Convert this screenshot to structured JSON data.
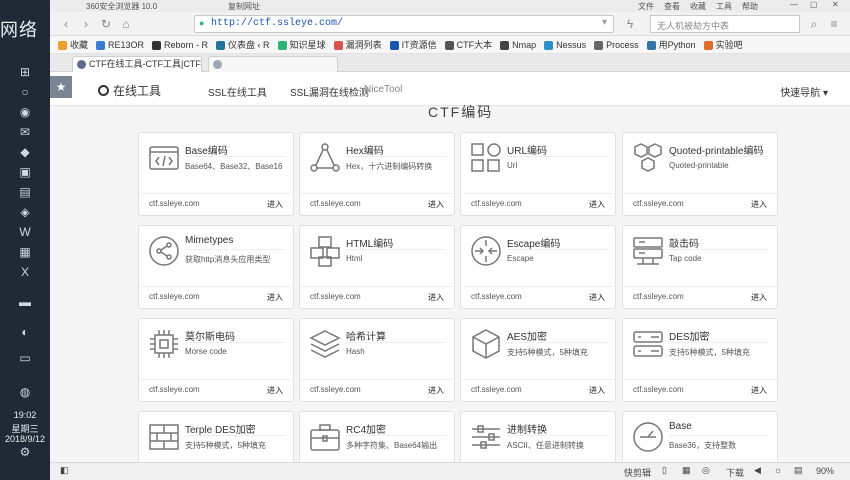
{
  "taskbar": {
    "desktop_text": "网络",
    "time": "19:02",
    "weekday": "星期三",
    "date": "2018/9/12"
  },
  "browser": {
    "app_title": "360安全浏览器 10.0",
    "menu": [
      "文件",
      "查看",
      "收藏",
      "工具",
      "帮助"
    ],
    "url": "http://ctf.ssleye.com/",
    "copy_url_label": "复制网址",
    "search_placeholder": "无人机被劫方中表",
    "bookmarks": [
      {
        "label": "收藏",
        "color": "#f0a030"
      },
      {
        "label": "RE13OR",
        "color": "#3a7bd5"
      },
      {
        "label": "Reborn - R",
        "color": "#333333"
      },
      {
        "label": "仪表盘 ‹ R",
        "color": "#21759b"
      },
      {
        "label": "知识星球",
        "color": "#2bb673"
      },
      {
        "label": "漏洞列表",
        "color": "#d9534f"
      },
      {
        "label": "IT资源信",
        "color": "#1a55b3"
      },
      {
        "label": "CTF大本",
        "color": "#555555"
      },
      {
        "label": "Nmap",
        "color": "#444444"
      },
      {
        "label": "Nessus",
        "color": "#2b8fcc"
      },
      {
        "label": "Process",
        "color": "#666666"
      },
      {
        "label": "用Python",
        "color": "#3572a5"
      },
      {
        "label": "实验吧",
        "color": "#e06c2a"
      }
    ],
    "tabs": [
      {
        "label": "CTF在线工具-CTF工具|CTF编",
        "active": true
      },
      {
        "label": "",
        "active": false
      }
    ],
    "status": {
      "quickclip": "快剪辑",
      "download": "下载",
      "zoom": "90%"
    }
  },
  "site": {
    "brand": "在线工具",
    "nav": [
      "SSL在线工具",
      "SSL漏洞在线检测",
      "NiceTool"
    ],
    "quick_nav": "快速导航",
    "section_title": "CTF编码"
  },
  "cards": [
    {
      "title": "Base编码",
      "desc": "Base64、Base32、Base16",
      "domain": "ctf.ssleye.com",
      "enter": "进入",
      "icon": "code-window-icon"
    },
    {
      "title": "Hex编码",
      "desc": "Hex，十六进制编码转换",
      "domain": "ctf.ssleye.com",
      "enter": "进入",
      "icon": "triangle-nodes-icon"
    },
    {
      "title": "URL编码",
      "desc": "Url",
      "domain": "ctf.ssleye.com",
      "enter": "进入",
      "icon": "shapes-icon"
    },
    {
      "title": "Quoted-printable编码",
      "desc": "Quoted-printable",
      "domain": "ctf.ssleye.com",
      "enter": "进入",
      "icon": "hexagons-icon"
    },
    {
      "title": "Mimetypes",
      "desc": "获取http消息头应用类型",
      "domain": "ctf.ssleye.com",
      "enter": "进入",
      "icon": "share-icon"
    },
    {
      "title": "HTML编码",
      "desc": "Html",
      "domain": "ctf.ssleye.com",
      "enter": "进入",
      "icon": "boxes-icon"
    },
    {
      "title": "Escape编码",
      "desc": "Escape",
      "domain": "ctf.ssleye.com",
      "enter": "进入",
      "icon": "arrows-circle-icon"
    },
    {
      "title": "敲击码",
      "desc": "Tap code",
      "domain": "ctf.ssleye.com",
      "enter": "进入",
      "icon": "server-icon"
    },
    {
      "title": "莫尔斯电码",
      "desc": "Morse code",
      "domain": "ctf.ssleye.com",
      "enter": "进入",
      "icon": "chip-icon"
    },
    {
      "title": "哈希计算",
      "desc": "Hash",
      "domain": "ctf.ssleye.com",
      "enter": "进入",
      "icon": "layers-icon"
    },
    {
      "title": "AES加密",
      "desc": "支持5种模式，5种填充",
      "domain": "ctf.ssleye.com",
      "enter": "进入",
      "icon": "cube-icon"
    },
    {
      "title": "DES加密",
      "desc": "支持5种模式，5种填充",
      "domain": "ctf.ssleye.com",
      "enter": "进入",
      "icon": "drive-icon"
    },
    {
      "title": "Terple DES加密",
      "desc": "支持5种模式，5种填充",
      "domain": "",
      "enter": "",
      "icon": "brick-wall-icon"
    },
    {
      "title": "RC4加密",
      "desc": "多种字符集、Base64输出",
      "domain": "",
      "enter": "",
      "icon": "briefcase-icon"
    },
    {
      "title": "进制转换",
      "desc": "ASCII、任意进制转换",
      "domain": "",
      "enter": "",
      "icon": "sliders-icon"
    },
    {
      "title": "Base",
      "desc": "Base36，支持整数",
      "domain": "",
      "enter": "",
      "icon": "dial-icon"
    }
  ]
}
